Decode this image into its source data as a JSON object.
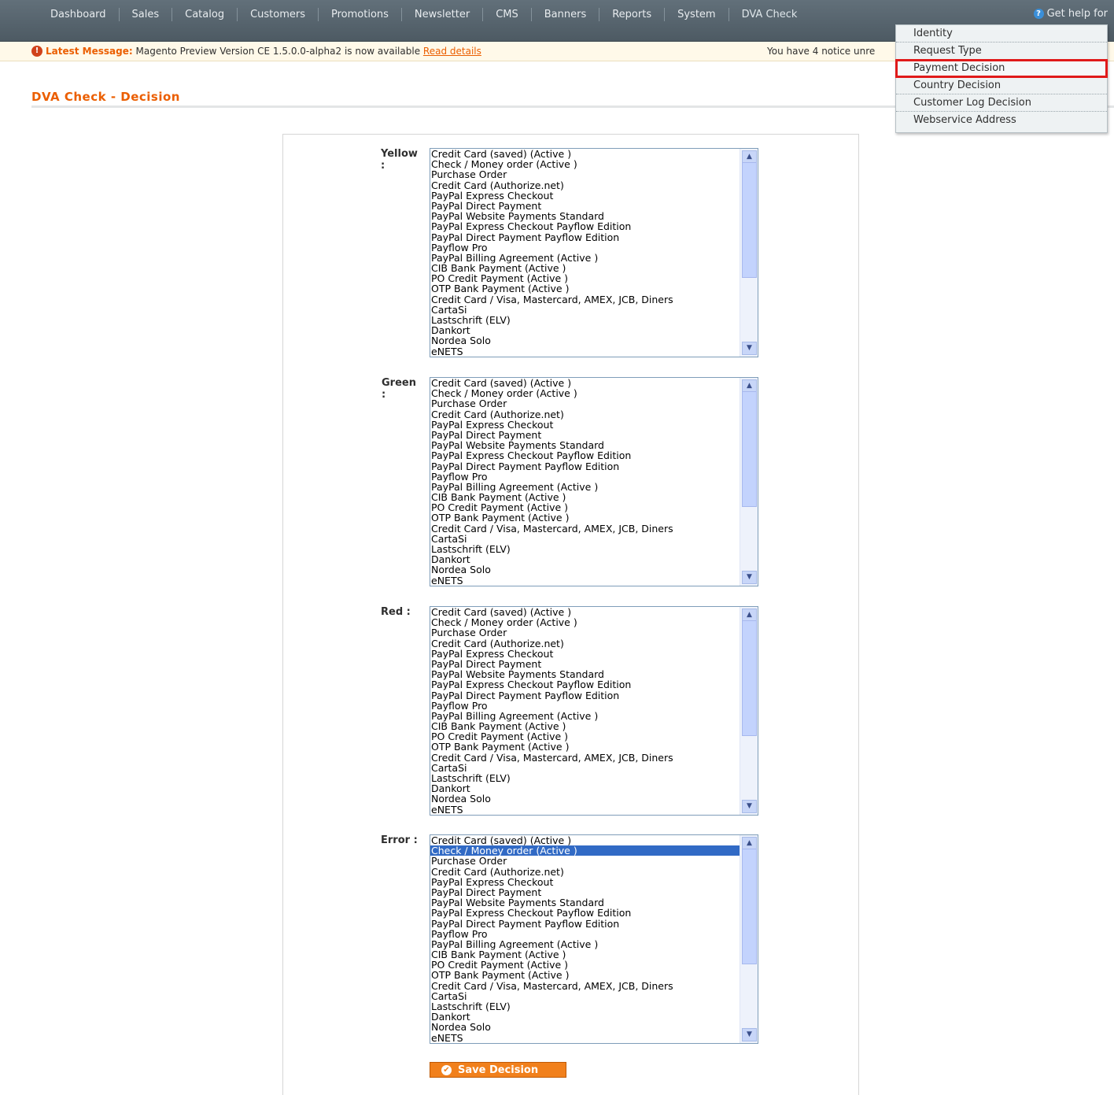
{
  "nav": {
    "items": [
      "Dashboard",
      "Sales",
      "Catalog",
      "Customers",
      "Promotions",
      "Newsletter",
      "CMS",
      "Banners",
      "Reports",
      "System",
      "DVA Check"
    ],
    "help": "Get help for"
  },
  "message": {
    "label": "Latest Message:",
    "text": "Magento Preview Version CE 1.5.0.0-alpha2 is now available",
    "link": "Read details",
    "notice": "You have 4 notice unre"
  },
  "page_title": "DVA Check - Decision",
  "dropdown": {
    "items": [
      "Identity",
      "Request Type",
      "Payment Decision",
      "Country Decision",
      "Customer Log Decision",
      "Webservice Address"
    ],
    "highlighted": "Payment Decision"
  },
  "options": [
    "Credit Card (saved) (Active )",
    "Check / Money order (Active )",
    "Purchase Order",
    "Credit Card (Authorize.net)",
    "PayPal Express Checkout",
    "PayPal Direct Payment",
    "PayPal Website Payments Standard",
    "PayPal Express Checkout Payflow Edition",
    "PayPal Direct Payment Payflow Edition",
    "Payflow Pro",
    "PayPal Billing Agreement (Active )",
    "CIB Bank Payment (Active )",
    "PO Credit Payment (Active )",
    "OTP Bank Payment (Active )",
    "Credit Card / Visa, Mastercard, AMEX, JCB, Diners",
    "CartaSi",
    "Lastschrift (ELV)",
    "Dankort",
    "Nordea Solo",
    "eNETS"
  ],
  "rows": [
    {
      "label": "Yellow",
      "selected": null
    },
    {
      "label": "Green",
      "selected": null
    },
    {
      "label": "Red",
      "selected": null
    },
    {
      "label": "Error",
      "selected": "Check / Money order (Active )"
    }
  ],
  "save_button": "Save Decision",
  "colors": {
    "accent": "#eb5e00",
    "button": "#f1801c",
    "selection": "#316ac5",
    "highlight_box": "#e01a1a"
  }
}
